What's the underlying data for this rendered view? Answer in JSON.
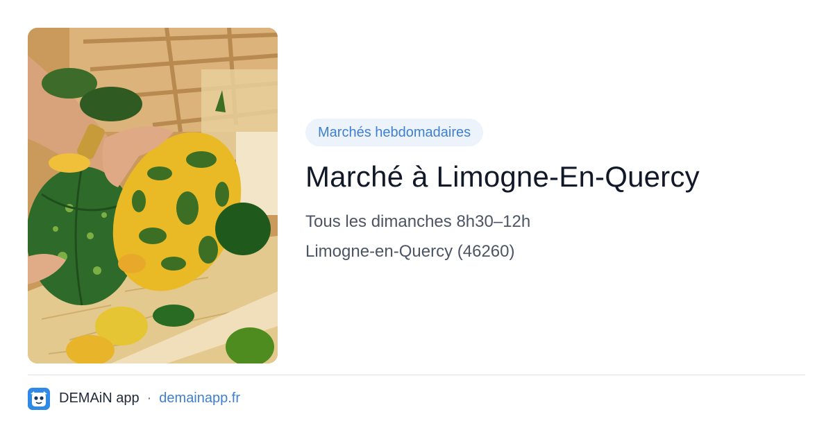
{
  "photo": {
    "icon": "market-vegetables-photo"
  },
  "category": {
    "label": "Marchés hebdomadaires"
  },
  "market": {
    "title": "Marché à Limogne-En-Quercy",
    "schedule": "Tous les dimanches 8h30–12h",
    "location": "Limogne-en-Quercy (46260)"
  },
  "footer": {
    "app_name": "DEMAiN app",
    "separator": "·",
    "site": "demainapp.fr",
    "logo_icon": "demain-app-logo-icon"
  },
  "colors": {
    "accent": "#3f7fd0",
    "pill_bg": "#edf3fb",
    "title": "#111827",
    "muted": "#4b5563"
  }
}
